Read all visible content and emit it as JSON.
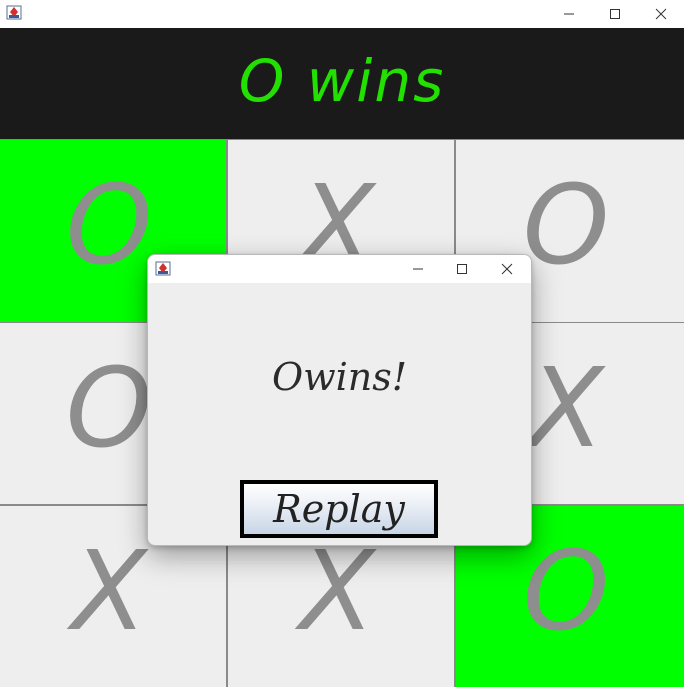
{
  "window": {
    "icon": "java-app-icon",
    "controls": {
      "minimize": "—",
      "maximize": "☐",
      "close": "✕"
    }
  },
  "banner": {
    "text": "O wins",
    "color": "#22e000"
  },
  "board": {
    "winning_color": "#00ff00",
    "cells": [
      {
        "mark": "O",
        "winning": true
      },
      {
        "mark": "X",
        "winning": false
      },
      {
        "mark": "O",
        "winning": false
      },
      {
        "mark": "O",
        "winning": false
      },
      {
        "mark": "",
        "winning": false
      },
      {
        "mark": "X",
        "winning": false
      },
      {
        "mark": "X",
        "winning": false
      },
      {
        "mark": "X",
        "winning": false
      },
      {
        "mark": "O",
        "winning": true
      }
    ]
  },
  "dialog": {
    "icon": "java-app-icon",
    "controls": {
      "minimize": "—",
      "maximize": "☐",
      "close": "✕"
    },
    "message": "Owins!",
    "button_label": "Replay"
  }
}
